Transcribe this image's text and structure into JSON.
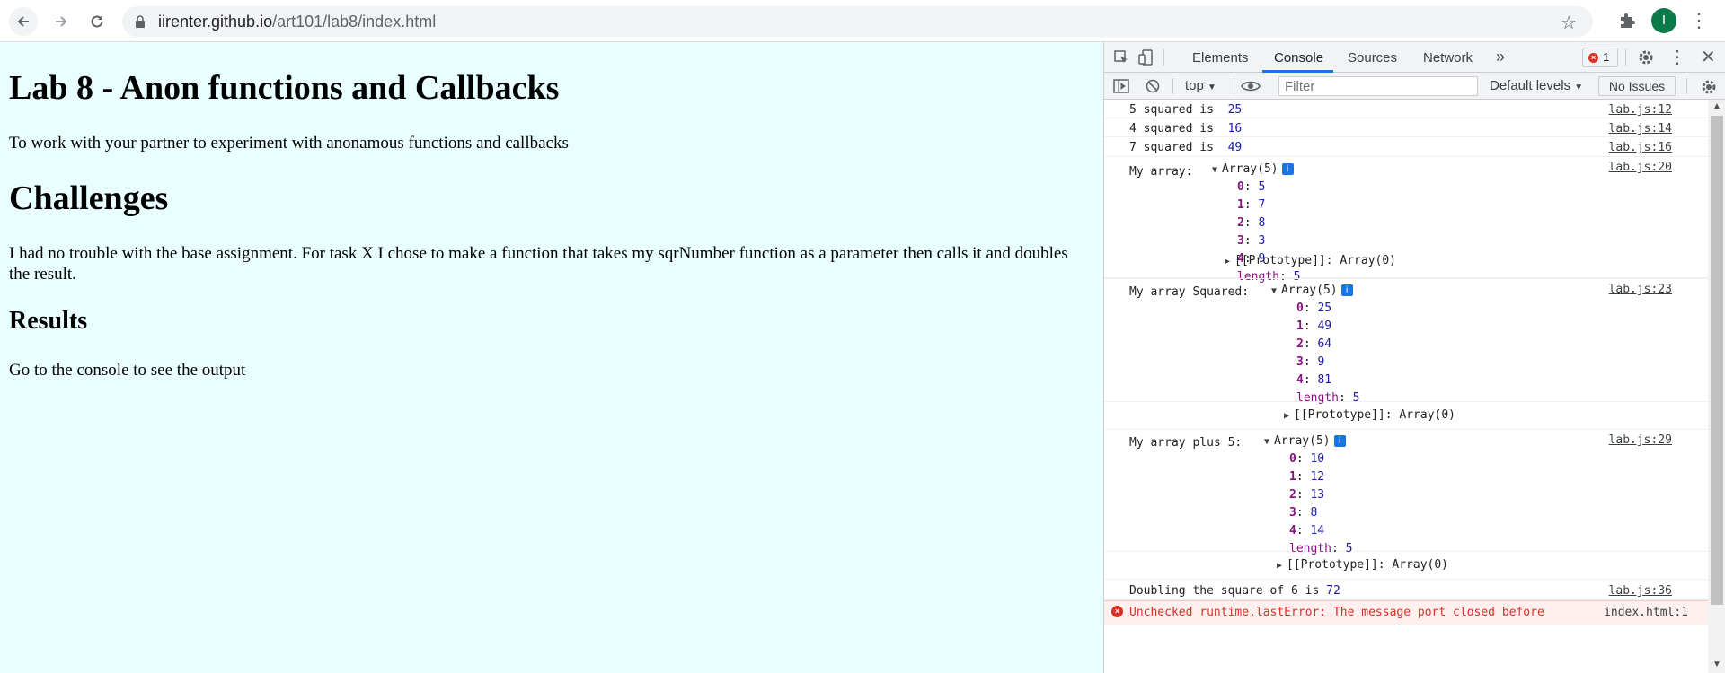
{
  "browser": {
    "url_host": "iirenter.github.io",
    "url_path": "/art101/lab8/index.html",
    "avatar_letter": "I"
  },
  "page": {
    "title": "Lab 8 - Anon functions and Callbacks",
    "intro": "To work with your partner to experiment with anonamous functions and callbacks",
    "challenges_heading": "Challenges",
    "challenges_text": "I had no trouble with the base assignment. For task X I chose to make a function that takes my sqrNumber function as a parameter then calls it and doubles the result.",
    "results_heading": "Results",
    "results_text": "Go to the console to see the output",
    "background_color": "#e9fefe"
  },
  "devtools": {
    "tabs": [
      "Elements",
      "Console",
      "Sources",
      "Network"
    ],
    "more_tabs": "»",
    "active_tab": "Console",
    "error_count": "1",
    "context": "top",
    "filter_placeholder": "Filter",
    "levels": "Default levels",
    "issues": "No Issues",
    "logs": [
      {
        "label": "5 squared is ",
        "value": "25",
        "source": "lab.js:12"
      },
      {
        "label": "4 squared is ",
        "value": "16",
        "source": "lab.js:14"
      },
      {
        "label": "7 squared is ",
        "value": "49",
        "source": "lab.js:16"
      }
    ],
    "arrays": [
      {
        "label": "My array: ",
        "summary": "Array(5)",
        "items": [
          "5",
          "7",
          "8",
          "3",
          "9"
        ],
        "length": "5",
        "proto": "[[Prototype]]: Array(0)",
        "source": "lab.js:20"
      },
      {
        "label": "My array Squared: ",
        "summary": "Array(5)",
        "items": [
          "25",
          "49",
          "64",
          "9",
          "81"
        ],
        "length": "5",
        "proto": "[[Prototype]]: Array(0)",
        "source": "lab.js:23"
      },
      {
        "label": "My array plus 5: ",
        "summary": "Array(5)",
        "items": [
          "10",
          "12",
          "13",
          "8",
          "14"
        ],
        "length": "5",
        "proto": "[[Prototype]]: Array(0)",
        "source": "lab.js:29"
      }
    ],
    "doubling": {
      "label": "Doubling the square of 6 is ",
      "value": "72",
      "source": "lab.js:36"
    },
    "error": {
      "text": "Unchecked runtime.lastError: The message port closed before",
      "source": "index.html:1"
    }
  }
}
